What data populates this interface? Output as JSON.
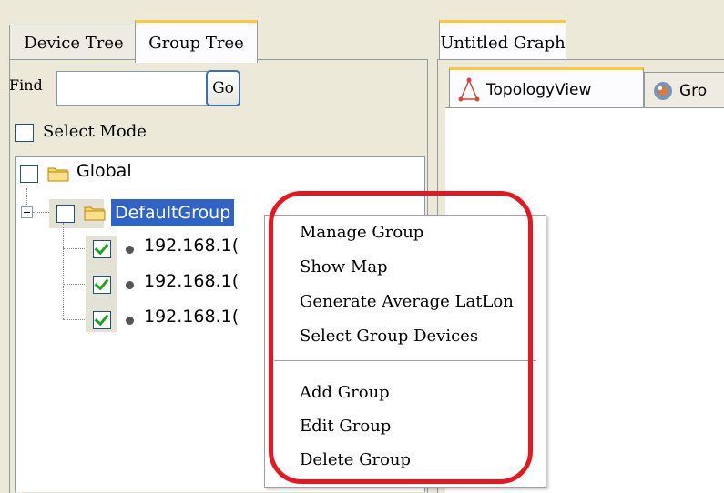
{
  "left_panel": {
    "tabs": [
      {
        "label": "Device Tree",
        "active": false
      },
      {
        "label": "Group Tree",
        "active": true
      }
    ],
    "find_label": "Find",
    "find_value": "",
    "go_button": "Go",
    "select_mode_label": "Select Mode",
    "tree": {
      "root": {
        "label": "Global",
        "checked": false
      },
      "group": {
        "label": "DefaultGroup",
        "checked": false,
        "selected": true,
        "expanded": true
      },
      "devices": [
        {
          "label": "192.168.1(",
          "checked": true
        },
        {
          "label": "192.168.1(",
          "checked": true
        },
        {
          "label": "192.168.1(",
          "checked": true
        }
      ]
    }
  },
  "right_panel": {
    "graph_tab": "Untitled Graph",
    "view_tabs": [
      {
        "label": "TopologyView",
        "icon": "topology-icon",
        "active": true
      },
      {
        "label": "Gro",
        "icon": "group-view-icon",
        "active": false
      }
    ]
  },
  "context_menu": {
    "items_top": [
      "Manage Group",
      "Show Map",
      "Generate Average LatLon",
      "Select Group Devices"
    ],
    "items_bottom": [
      "Add Group",
      "Edit Group",
      "Delete Group"
    ]
  },
  "colors": {
    "tab_accent": "#ffc83c",
    "selection": "#3163c6",
    "highlight_ring": "#e8171f",
    "checkmark": "#21a121"
  }
}
